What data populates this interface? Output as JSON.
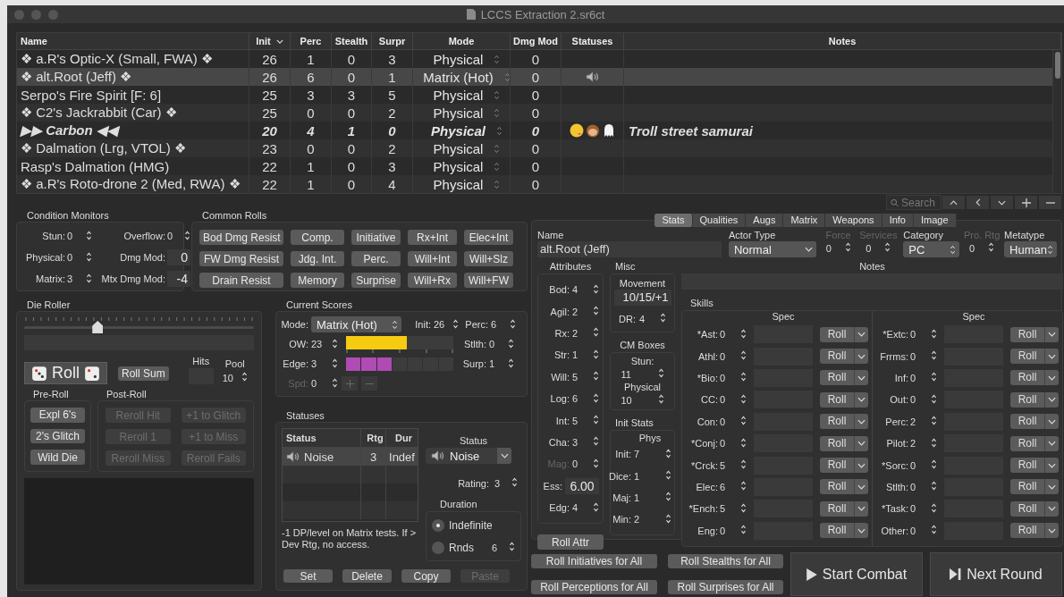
{
  "window": {
    "title": "LCCS Extraction 2.sr6ct"
  },
  "table": {
    "columns": [
      {
        "label": "Name",
        "sorted": false
      },
      {
        "label": "Init",
        "sorted": true
      },
      {
        "label": "Perc",
        "sorted": false
      },
      {
        "label": "Stealth",
        "sorted": false
      },
      {
        "label": "Surpr",
        "sorted": false
      },
      {
        "label": "Mode",
        "sorted": false
      },
      {
        "label": "Dmg Mod",
        "sorted": false
      },
      {
        "label": "Statuses",
        "sorted": false
      },
      {
        "label": "Notes",
        "sorted": false
      }
    ],
    "rows": [
      {
        "name": "❖ a.R's Optic-X (Small, FWA) ❖",
        "init": "26",
        "perc": "1",
        "stealth": "0",
        "surpr": "3",
        "mode": "Physical",
        "dmg_mod": "0",
        "selected": false,
        "current": false
      },
      {
        "name": "❖ alt.Root (Jeff) ❖",
        "init": "26",
        "perc": "6",
        "stealth": "0",
        "surpr": "1",
        "mode": "Matrix (Hot)",
        "dmg_mod": "0",
        "statuses": [
          {
            "kind": "noise"
          }
        ],
        "selected": true,
        "current": false
      },
      {
        "name": "Serpo's Fire Spirit [F: 6]",
        "init": "25",
        "perc": "3",
        "stealth": "3",
        "surpr": "5",
        "mode": "Physical",
        "dmg_mod": "0",
        "selected": false,
        "current": false
      },
      {
        "name": "❖ C2's Jackrabbit (Car) ❖",
        "init": "25",
        "perc": "0",
        "stealth": "0",
        "surpr": "2",
        "mode": "Physical",
        "dmg_mod": "0",
        "selected": false,
        "current": false
      },
      {
        "name": "▶▶ Carbon ◀◀",
        "init": "20",
        "perc": "4",
        "stealth": "1",
        "surpr": "0",
        "mode": "Physical",
        "dmg_mod": "0",
        "statuses": [
          {
            "kind": "dizzy"
          },
          {
            "kind": "monkey"
          },
          {
            "kind": "ghost"
          }
        ],
        "notes": "Troll street samurai",
        "selected": false,
        "current": true
      },
      {
        "name": "❖ Dalmation (Lrg, VTOL) ❖",
        "init": "23",
        "perc": "0",
        "stealth": "0",
        "surpr": "2",
        "mode": "Physical",
        "dmg_mod": "0",
        "selected": false,
        "current": false
      },
      {
        "name": "Rasp's Dalmation (HMG)",
        "init": "22",
        "perc": "1",
        "stealth": "0",
        "surpr": "3",
        "mode": "Physical",
        "dmg_mod": "0",
        "selected": false,
        "current": false
      },
      {
        "name": "❖ a.R's Roto-drone 2 (Med, RWA) ❖",
        "init": "22",
        "perc": "1",
        "stealth": "0",
        "surpr": "4",
        "mode": "Physical",
        "dmg_mod": "0",
        "selected": false,
        "current": false
      }
    ]
  },
  "search": {
    "placeholder": "Search"
  },
  "condition_monitors": {
    "title": "Condition Monitors",
    "fields": [
      {
        "label": "Stun:",
        "value": "0",
        "kind": "stepper"
      },
      {
        "label": "Overflow:",
        "value": "0",
        "kind": "stepper"
      },
      {
        "label": "Physical:",
        "value": "0",
        "kind": "stepper"
      },
      {
        "label": "Dmg Mod:",
        "value": "0",
        "kind": "field"
      },
      {
        "label": "Matrix:",
        "value": "3",
        "kind": "stepper"
      },
      {
        "label": "Mtx Dmg Mod:",
        "value": "-4",
        "kind": "field"
      }
    ]
  },
  "common_rolls": {
    "title": "Common Rolls",
    "buttons": [
      "Bod Dmg Resist",
      "Comp.",
      "Initiative",
      "Rx+Int",
      "Elec+Int",
      "FW Dmg Resist",
      "Jdg. Int.",
      "Perc.",
      "Will+Int",
      "Will+Slz",
      "Drain Resist",
      "Memory",
      "Surprise",
      "Will+Rx",
      "Will+FW"
    ]
  },
  "die_roller": {
    "title": "Die Roller",
    "slider": {
      "level": 0.32
    },
    "roll_button": "Roll",
    "roll_sum_button": "Roll Sum",
    "hits": {
      "label": "Hits"
    },
    "pool": {
      "label": "Pool",
      "value": "10"
    },
    "pre_roll": {
      "title": "Pre-Roll",
      "buttons": [
        {
          "label": "Expl 6's",
          "disabled": false
        },
        {
          "label": "2's Glitch",
          "disabled": false
        },
        {
          "label": "Wild Die",
          "disabled": false
        }
      ]
    },
    "post_roll": {
      "title": "Post-Roll",
      "buttons": [
        {
          "label": "Reroll Hit",
          "disabled": true
        },
        {
          "label": "+1 to Glitch",
          "disabled": true
        },
        {
          "label": "Reroll 1",
          "disabled": true
        },
        {
          "label": "+1 to Miss",
          "disabled": true
        },
        {
          "label": "Reroll Miss",
          "disabled": true
        },
        {
          "label": "Reroll Fails",
          "disabled": true
        }
      ]
    }
  },
  "current_scores": {
    "title": "Current Scores",
    "mode": {
      "label": "Mode:",
      "value": "Matrix (Hot)"
    },
    "init": {
      "label": "Init:",
      "value": "26"
    },
    "perc": {
      "label": "Perc:",
      "value": "6"
    },
    "ow": {
      "label": "OW:",
      "value": "23",
      "level": 0.57
    },
    "stlth": {
      "label": "Stlth:",
      "value": "0"
    },
    "edge": {
      "label": "Edge:",
      "value": "3",
      "segments": [
        {
          "filled": true
        },
        {
          "filled": true
        },
        {
          "filled": true
        },
        {
          "filled": false
        },
        {
          "filled": false
        },
        {
          "filled": false
        },
        {
          "filled": false
        }
      ]
    },
    "surp": {
      "label": "Surp:",
      "value": "1"
    },
    "spd": {
      "label": "Spd:",
      "value": "0",
      "disabled": true
    }
  },
  "statuses": {
    "title": "Statuses",
    "table": {
      "columns": [
        "Status",
        "Rtg",
        "Dur"
      ],
      "rows": [
        {
          "kind": "noise",
          "status": "Noise",
          "rtg": "3",
          "dur": "Indef",
          "selected": true
        }
      ]
    },
    "description": "-1 DP/level on Matrix tests. If > Dev Rtg, no access.",
    "status_select": {
      "label": "Status",
      "kind": "noise",
      "value": "Noise"
    },
    "rating": {
      "label": "Rating:",
      "value": "3"
    },
    "duration": {
      "title": "Duration",
      "options": [
        {
          "label": "Indefinite",
          "selected": true
        },
        {
          "label": "Rnds",
          "selected": false,
          "value": "6"
        }
      ]
    },
    "buttons": [
      {
        "label": "Set",
        "disabled": false
      },
      {
        "label": "Delete",
        "disabled": false
      },
      {
        "label": "Copy",
        "disabled": false
      },
      {
        "label": "Paste",
        "disabled": true
      }
    ]
  },
  "tabs": [
    {
      "label": "Stats",
      "selected": true
    },
    {
      "label": "Qualities",
      "selected": false
    },
    {
      "label": "Augs",
      "selected": false
    },
    {
      "label": "Matrix",
      "selected": false
    },
    {
      "label": "Weapons",
      "selected": false
    },
    {
      "label": "Info",
      "selected": false
    },
    {
      "label": "Image",
      "selected": false
    }
  ],
  "actor": {
    "name": {
      "label": "Name",
      "value": "alt.Root (Jeff)"
    },
    "actor_type": {
      "label": "Actor Type",
      "value": "Normal"
    },
    "force": {
      "label": "Force",
      "value": "0",
      "disabled": true
    },
    "services": {
      "label": "Services",
      "value": "0",
      "disabled": true
    },
    "category": {
      "label": "Category",
      "value": "PC"
    },
    "pro_rtg": {
      "label": "Pro. Rtg",
      "value": "0",
      "disabled": true
    },
    "metatype": {
      "label": "Metatype",
      "value": "Human"
    }
  },
  "attributes": {
    "title": "Attributes",
    "items": [
      {
        "label": "Bod:",
        "value": "4",
        "kind": "stepper",
        "disabled": false
      },
      {
        "label": "Agil:",
        "value": "2",
        "kind": "stepper",
        "disabled": false
      },
      {
        "label": "Rx:",
        "value": "2",
        "kind": "stepper",
        "disabled": false
      },
      {
        "label": "Str:",
        "value": "1",
        "kind": "stepper",
        "disabled": false
      },
      {
        "label": "Will:",
        "value": "5",
        "kind": "stepper",
        "disabled": false
      },
      {
        "label": "Log:",
        "value": "6",
        "kind": "stepper",
        "disabled": false
      },
      {
        "label": "Int:",
        "value": "5",
        "kind": "stepper",
        "disabled": false
      },
      {
        "label": "Cha:",
        "value": "3",
        "kind": "stepper",
        "disabled": false
      },
      {
        "label": "Mag:",
        "value": "0",
        "kind": "stepper",
        "disabled": true
      },
      {
        "label": "Ess:",
        "value": "6.00",
        "kind": "field",
        "disabled": false
      },
      {
        "label": "Edg:",
        "value": "4",
        "kind": "stepper",
        "disabled": false
      }
    ],
    "roll_button": "Roll Attr"
  },
  "misc": {
    "title": "Misc",
    "movement": {
      "label": "Movement",
      "value": "10/15/+1"
    },
    "dr": {
      "label": "DR:",
      "value": "4"
    }
  },
  "cm_boxes": {
    "title": "CM Boxes",
    "stun": {
      "label": "Stun:",
      "value": "11"
    },
    "physical": {
      "label": "Physical",
      "value": "10"
    }
  },
  "init_stats": {
    "title": "Init Stats",
    "heading": "Phys",
    "items": [
      {
        "label": "Init:",
        "value": "7"
      },
      {
        "label": "Dice:",
        "value": "1"
      },
      {
        "label": "Maj:",
        "value": "1"
      },
      {
        "label": "Min:",
        "value": "2"
      }
    ]
  },
  "notes": {
    "label": "Notes"
  },
  "skills": {
    "title": "Skills",
    "columns": [
      {
        "spec_heading": "Spec",
        "items": [
          {
            "label": "*Ast:",
            "value": "0",
            "roll": "Roll"
          },
          {
            "label": "Athl:",
            "value": "0",
            "roll": "Roll"
          },
          {
            "label": "*Bio:",
            "value": "0",
            "roll": "Roll"
          },
          {
            "label": "CC:",
            "value": "0",
            "roll": "Roll"
          },
          {
            "label": "Con:",
            "value": "0",
            "roll": "Roll"
          },
          {
            "label": "*Conj:",
            "value": "0",
            "roll": "Roll"
          },
          {
            "label": "*Crck:",
            "value": "5",
            "roll": "Roll"
          },
          {
            "label": "Elec:",
            "value": "6",
            "roll": "Roll"
          },
          {
            "label": "*Ench:",
            "value": "5",
            "roll": "Roll"
          },
          {
            "label": "Eng:",
            "value": "0",
            "roll": "Roll"
          }
        ]
      },
      {
        "spec_heading": "Spec",
        "items": [
          {
            "label": "*Extc:",
            "value": "0",
            "roll": "Roll"
          },
          {
            "label": "Frrms:",
            "value": "0",
            "roll": "Roll"
          },
          {
            "label": "Inf:",
            "value": "0",
            "roll": "Roll"
          },
          {
            "label": "Out:",
            "value": "0",
            "roll": "Roll"
          },
          {
            "label": "Perc:",
            "value": "2",
            "roll": "Roll"
          },
          {
            "label": "Pilot:",
            "value": "2",
            "roll": "Roll"
          },
          {
            "label": "*Sorc:",
            "value": "0",
            "roll": "Roll"
          },
          {
            "label": "Stlth:",
            "value": "0",
            "roll": "Roll"
          },
          {
            "label": "*Task:",
            "value": "0",
            "roll": "Roll"
          },
          {
            "label": "Other:",
            "value": "0",
            "roll": "Roll"
          }
        ]
      }
    ]
  },
  "footer": {
    "buttons": [
      "Roll Initiatives for All",
      "Roll Stealths for All",
      "Roll Perceptions for All",
      "Roll Surprises for All"
    ],
    "start_combat": "Start Combat",
    "next_round": "Next Round"
  }
}
